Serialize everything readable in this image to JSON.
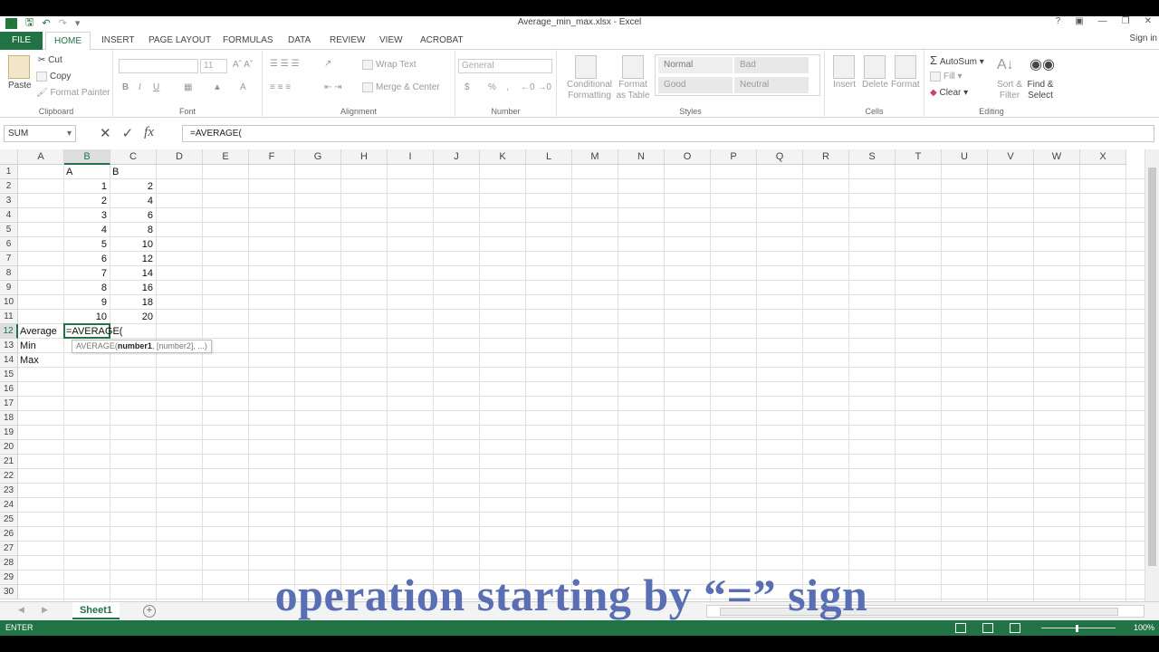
{
  "window": {
    "title": "Average_min_max.xlsx - Excel",
    "help": "?",
    "sign_in": "Sign in"
  },
  "tabs": [
    {
      "label": "FILE"
    },
    {
      "label": "HOME",
      "active": true
    },
    {
      "label": "INSERT"
    },
    {
      "label": "PAGE LAYOUT"
    },
    {
      "label": "FORMULAS"
    },
    {
      "label": "DATA"
    },
    {
      "label": "REVIEW"
    },
    {
      "label": "VIEW"
    },
    {
      "label": "ACROBAT"
    }
  ],
  "ribbon": {
    "clipboard": {
      "label": "Clipboard",
      "paste": "Paste",
      "cut": "Cut",
      "copy": "Copy",
      "format_painter": "Format Painter"
    },
    "font": {
      "label": "Font",
      "size": "11",
      "bold": "B",
      "italic": "I",
      "underline": "U"
    },
    "alignment": {
      "label": "Alignment",
      "wrap_text": "Wrap Text",
      "merge_center": "Merge & Center"
    },
    "number": {
      "label": "Number",
      "format": "General",
      "currency": "$",
      "percent": "%"
    },
    "styles": {
      "label": "Styles",
      "conditional": "Conditional Formatting",
      "format_table": "Format as Table",
      "normal": "Normal",
      "bad": "Bad",
      "good": "Good",
      "neutral": "Neutral"
    },
    "cells": {
      "label": "Cells",
      "insert": "Insert",
      "delete": "Delete",
      "format": "Format"
    },
    "editing": {
      "label": "Editing",
      "autosum": "AutoSum",
      "fill": "Fill",
      "clear": "Clear",
      "sort_filter": "Sort & Filter",
      "find_select": "Find & Select"
    }
  },
  "formula_bar": {
    "name_box": "SUM",
    "fx": "fx",
    "formula": "=AVERAGE("
  },
  "grid": {
    "columns": [
      "A",
      "B",
      "C",
      "D",
      "E",
      "F",
      "G",
      "H",
      "I",
      "J",
      "K",
      "L",
      "M",
      "N",
      "O",
      "P",
      "Q",
      "R",
      "S",
      "T",
      "U",
      "V",
      "W",
      "X"
    ],
    "selected_column": "B",
    "selected_row": 12,
    "rows": 30,
    "header_row": {
      "B": "A",
      "C": "B"
    },
    "col_a": [
      1,
      2,
      3,
      4,
      5,
      6,
      7,
      8,
      9,
      10
    ],
    "col_b": [
      2,
      4,
      6,
      8,
      10,
      12,
      14,
      16,
      18,
      20
    ],
    "labels": {
      "average": "Average",
      "min": "Min",
      "max": "Max"
    },
    "active_cell_text": "=AVERAGE(",
    "tooltip": {
      "func": "AVERAGE(",
      "arg1": "number1",
      "rest": ", [number2], ...)"
    }
  },
  "sheets": [
    {
      "name": "Sheet1",
      "active": true
    }
  ],
  "status": {
    "mode": "ENTER",
    "zoom": "100%"
  },
  "caption": "operation starting by “=” sign"
}
